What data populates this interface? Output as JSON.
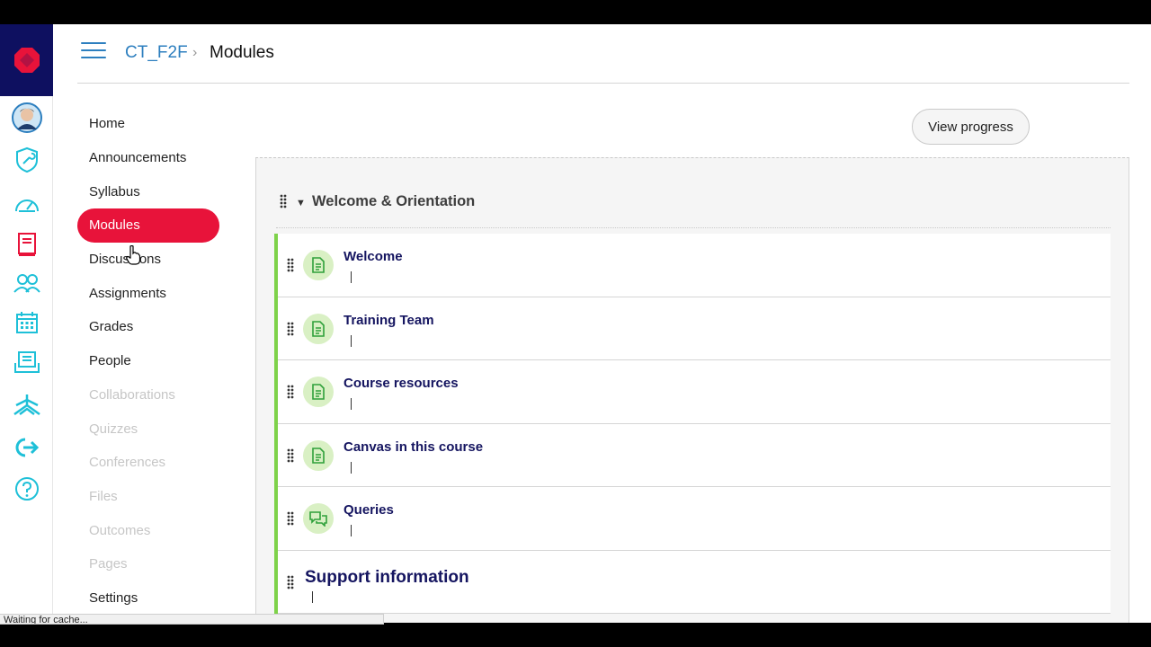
{
  "breadcrumb": {
    "course": "CT_F2F",
    "separator": "›",
    "current": "Modules"
  },
  "global_nav": {
    "items": [
      {
        "name": "account-avatar",
        "icon": "avatar"
      },
      {
        "name": "admin",
        "icon": "shield-wrench-icon"
      },
      {
        "name": "dashboard",
        "icon": "speedometer-icon"
      },
      {
        "name": "courses",
        "icon": "book-icon"
      },
      {
        "name": "groups",
        "icon": "people-icon"
      },
      {
        "name": "calendar",
        "icon": "calendar-icon"
      },
      {
        "name": "inbox",
        "icon": "inbox-icon"
      },
      {
        "name": "commons",
        "icon": "commons-icon"
      },
      {
        "name": "logout",
        "icon": "logout-arrow-icon"
      },
      {
        "name": "help",
        "icon": "help-icon"
      }
    ],
    "colors": {
      "logo_bg": "#0e1060",
      "logo": "#e8133a",
      "icons": "#1ec0d8",
      "active_icon": "#e8133a"
    }
  },
  "course_nav": {
    "items": [
      {
        "label": "Home",
        "state": "normal"
      },
      {
        "label": "Announcements",
        "state": "normal"
      },
      {
        "label": "Syllabus",
        "state": "normal"
      },
      {
        "label": "Modules",
        "state": "active"
      },
      {
        "label": "Discussions",
        "state": "normal"
      },
      {
        "label": "Assignments",
        "state": "normal"
      },
      {
        "label": "Grades",
        "state": "normal"
      },
      {
        "label": "People",
        "state": "normal"
      },
      {
        "label": "Collaborations",
        "state": "disabled"
      },
      {
        "label": "Quizzes",
        "state": "disabled"
      },
      {
        "label": "Conferences",
        "state": "disabled"
      },
      {
        "label": "Files",
        "state": "disabled"
      },
      {
        "label": "Outcomes",
        "state": "disabled"
      },
      {
        "label": "Pages",
        "state": "disabled"
      },
      {
        "label": "Settings",
        "state": "normal"
      }
    ],
    "active_color": "#e8133a"
  },
  "toolbar": {
    "view_progress_label": "View progress"
  },
  "module": {
    "title": "Welcome & Orientation",
    "items": [
      {
        "title": "Welcome",
        "icon": "page-icon",
        "type": "item"
      },
      {
        "title": "Training Team",
        "icon": "page-icon",
        "type": "item"
      },
      {
        "title": "Course resources",
        "icon": "page-icon",
        "type": "item"
      },
      {
        "title": "Canvas in this course",
        "icon": "page-icon",
        "type": "item"
      },
      {
        "title": "Queries",
        "icon": "discussion-icon",
        "type": "item"
      },
      {
        "title": "Support information",
        "icon": "",
        "type": "subheader"
      }
    ],
    "accent_color": "#7ed24a"
  },
  "status_bar": {
    "text": "Waiting for cache..."
  }
}
